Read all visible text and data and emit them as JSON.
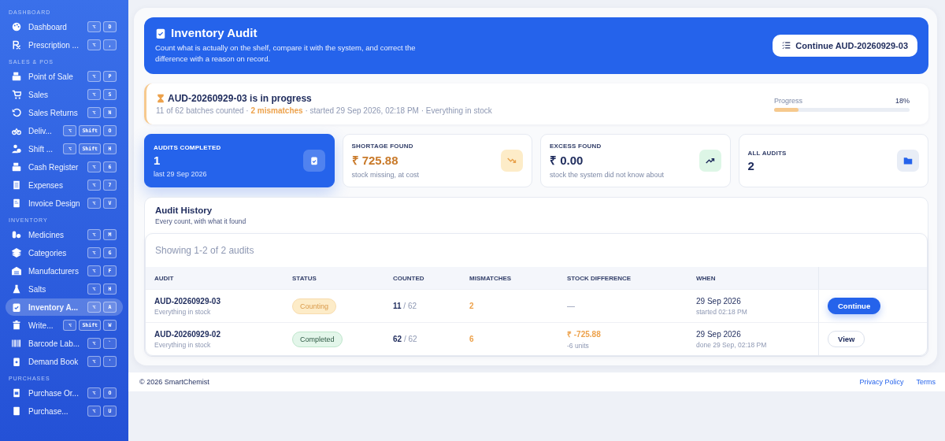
{
  "sidebar": {
    "sections": [
      {
        "title": "DASHBOARD",
        "items": [
          {
            "label": "Dashboard",
            "keys": [
              "⌥",
              "D"
            ],
            "selected": false
          },
          {
            "label": "Prescription ...",
            "keys": [
              "⌥",
              ","
            ],
            "selected": false
          }
        ]
      },
      {
        "title": "SALES & POS",
        "items": [
          {
            "label": "Point of Sale",
            "keys": [
              "⌥",
              "P"
            ],
            "selected": false
          },
          {
            "label": "Sales",
            "keys": [
              "⌥",
              "S"
            ],
            "selected": false
          },
          {
            "label": "Sales Returns",
            "keys": [
              "⌥",
              "N"
            ],
            "selected": false
          },
          {
            "label": "Deliv...",
            "keys": [
              "⌥",
              "Shift",
              "O"
            ],
            "selected": false
          },
          {
            "label": "Shift ...",
            "keys": [
              "⌥",
              "Shift",
              "H"
            ],
            "selected": false
          },
          {
            "label": "Cash Register",
            "keys": [
              "⌥",
              "6"
            ],
            "selected": false
          },
          {
            "label": "Expenses",
            "keys": [
              "⌥",
              "7"
            ],
            "selected": false
          },
          {
            "label": "Invoice Design",
            "keys": [
              "⌥",
              "V"
            ],
            "selected": false
          }
        ]
      },
      {
        "title": "INVENTORY",
        "items": [
          {
            "label": "Medicines",
            "keys": [
              "⌥",
              "M"
            ],
            "selected": false
          },
          {
            "label": "Categories",
            "keys": [
              "⌥",
              "G"
            ],
            "selected": false
          },
          {
            "label": "Manufacturers",
            "keys": [
              "⌥",
              "F"
            ],
            "selected": false
          },
          {
            "label": "Salts",
            "keys": [
              "⌥",
              "H"
            ],
            "selected": false
          },
          {
            "label": "Inventory A...",
            "keys": [
              "⌥",
              "A"
            ],
            "selected": true
          },
          {
            "label": "Write...",
            "keys": [
              "⌥",
              "Shift",
              "W"
            ],
            "selected": false
          },
          {
            "label": "Barcode Lab...",
            "keys": [
              "⌥",
              "`"
            ],
            "selected": false
          },
          {
            "label": "Demand Book",
            "keys": [
              "⌥",
              "'"
            ],
            "selected": false
          }
        ]
      },
      {
        "title": "PURCHASES",
        "items": [
          {
            "label": "Purchase Or...",
            "keys": [
              "⌥",
              "O"
            ],
            "selected": false
          },
          {
            "label": "Purchase...",
            "keys": [
              "⌥",
              "U"
            ],
            "selected": false
          }
        ]
      }
    ]
  },
  "hero": {
    "title": "Inventory Audit",
    "description": "Count what is actually on the shelf, compare it with the system, and correct the difference with a reason on record.",
    "button": "Continue AUD-20260929-03"
  },
  "progress_card": {
    "title": "AUD-20260929-03 is in progress",
    "details": "11 of 62 batches counted · **2 mismatches** · started 29 Sep 2026, 02:18 PM · Everything in stock",
    "progress_label": "Progress",
    "percent": "18%",
    "level": 0.18
  },
  "stats": [
    {
      "kind": "primary",
      "label": "AUDITS COMPLETED",
      "value": "1",
      "note": "last 29 Sep 2026"
    },
    {
      "kind": "shortage",
      "label": "SHORTAGE FOUND",
      "value": "₹ 725.88",
      "note": "stock missing, at cost"
    },
    {
      "kind": "excess",
      "label": "EXCESS FOUND",
      "value": "₹ 0.00",
      "note": "stock the system did not know about"
    },
    {
      "kind": "neutral",
      "label": "ALL AUDITS",
      "value": "2"
    }
  ],
  "history": {
    "title": "Audit History",
    "subtitle": "Every count, with what it found",
    "showing": "Showing 1-2 of 2 audits",
    "columns": [
      "AUDIT",
      "STATUS",
      "COUNTED",
      "MISMATCHES",
      "STOCK DIFFERENCE",
      "WHEN"
    ],
    "rows": [
      {
        "audit": "AUD-20260929-03",
        "audit_note": "Everything in stock",
        "status": {
          "label": "Counting",
          "kind": "counting"
        },
        "counted": "11",
        "total": "/ 62",
        "mismatches": "2",
        "difference": "—",
        "when": "29 Sep 2026",
        "when_note": "started 02:18 PM",
        "action": {
          "label": "Continue",
          "kind": "primary"
        }
      },
      {
        "audit": "AUD-20260929-02",
        "audit_note": "Everything in stock",
        "status": {
          "label": "Completed",
          "kind": "completed"
        },
        "counted": "62",
        "total": "/ 62",
        "mismatches": "6",
        "difference": "₹ -725.88",
        "difference_note": "-6 units",
        "when": "29 Sep 2026",
        "when_note": "done 29 Sep, 02:18 PM",
        "action": {
          "label": "View",
          "kind": "outline"
        }
      }
    ]
  },
  "footer": {
    "copyright": "© 2026 SmartChemist",
    "links": [
      "Privacy Policy",
      "Terms"
    ]
  }
}
